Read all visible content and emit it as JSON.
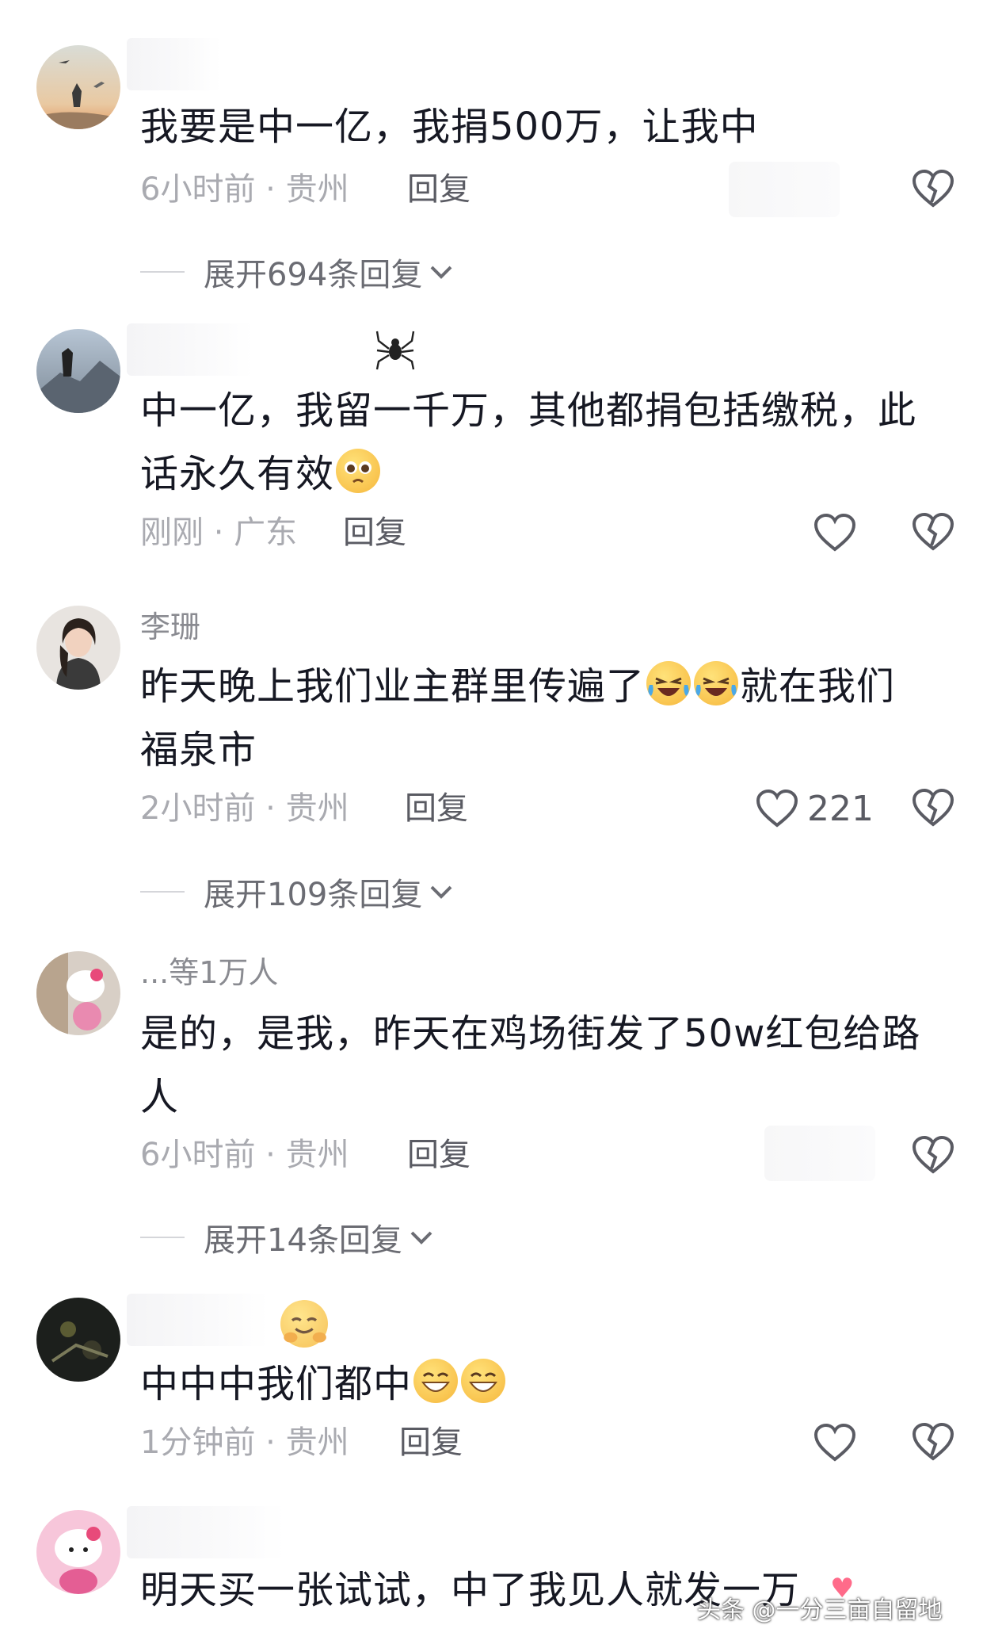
{
  "comments": [
    {
      "username": "",
      "text": "我要是中一亿，我捐500万，让我中",
      "meta": "6小时前 · 贵州",
      "reply": "回复",
      "likes": "",
      "expand": "展开694条回复"
    },
    {
      "username": "",
      "text_line1": "中一亿，我留一千万，其他都捐包括缴税，此",
      "text_line2": "话永久有效",
      "meta": "刚刚 · 广东",
      "reply": "回复",
      "likes": ""
    },
    {
      "username": "李珊",
      "text_line1a": "昨天晚上我们业主群里传遍了",
      "text_line1b": "就在我们",
      "text_line2": "福泉市",
      "meta": "2小时前 · 贵州",
      "reply": "回复",
      "likes": "221",
      "expand": "展开109条回复"
    },
    {
      "username": "...等1万人",
      "text_line1": "是的，是我，昨天在鸡场街发了50w红包给路",
      "text_line2": "人",
      "meta": "6小时前 · 贵州",
      "reply": "回复",
      "expand": "展开14条回复"
    },
    {
      "username": "",
      "text": "中中中我们都中",
      "meta": "1分钟前 · 贵州",
      "reply": "回复",
      "likes": ""
    },
    {
      "username": "",
      "text": "明天买一张试试，中了我见人就发一万"
    }
  ],
  "watermark": "头条 @一分三亩自留地",
  "icons": {
    "like": "heart-outline-icon",
    "dislike": "broken-heart-icon",
    "expand": "chevron-down-icon"
  },
  "colors": {
    "text": "#161823",
    "meta": "#a9aab0",
    "reply": "#5a5b63"
  }
}
